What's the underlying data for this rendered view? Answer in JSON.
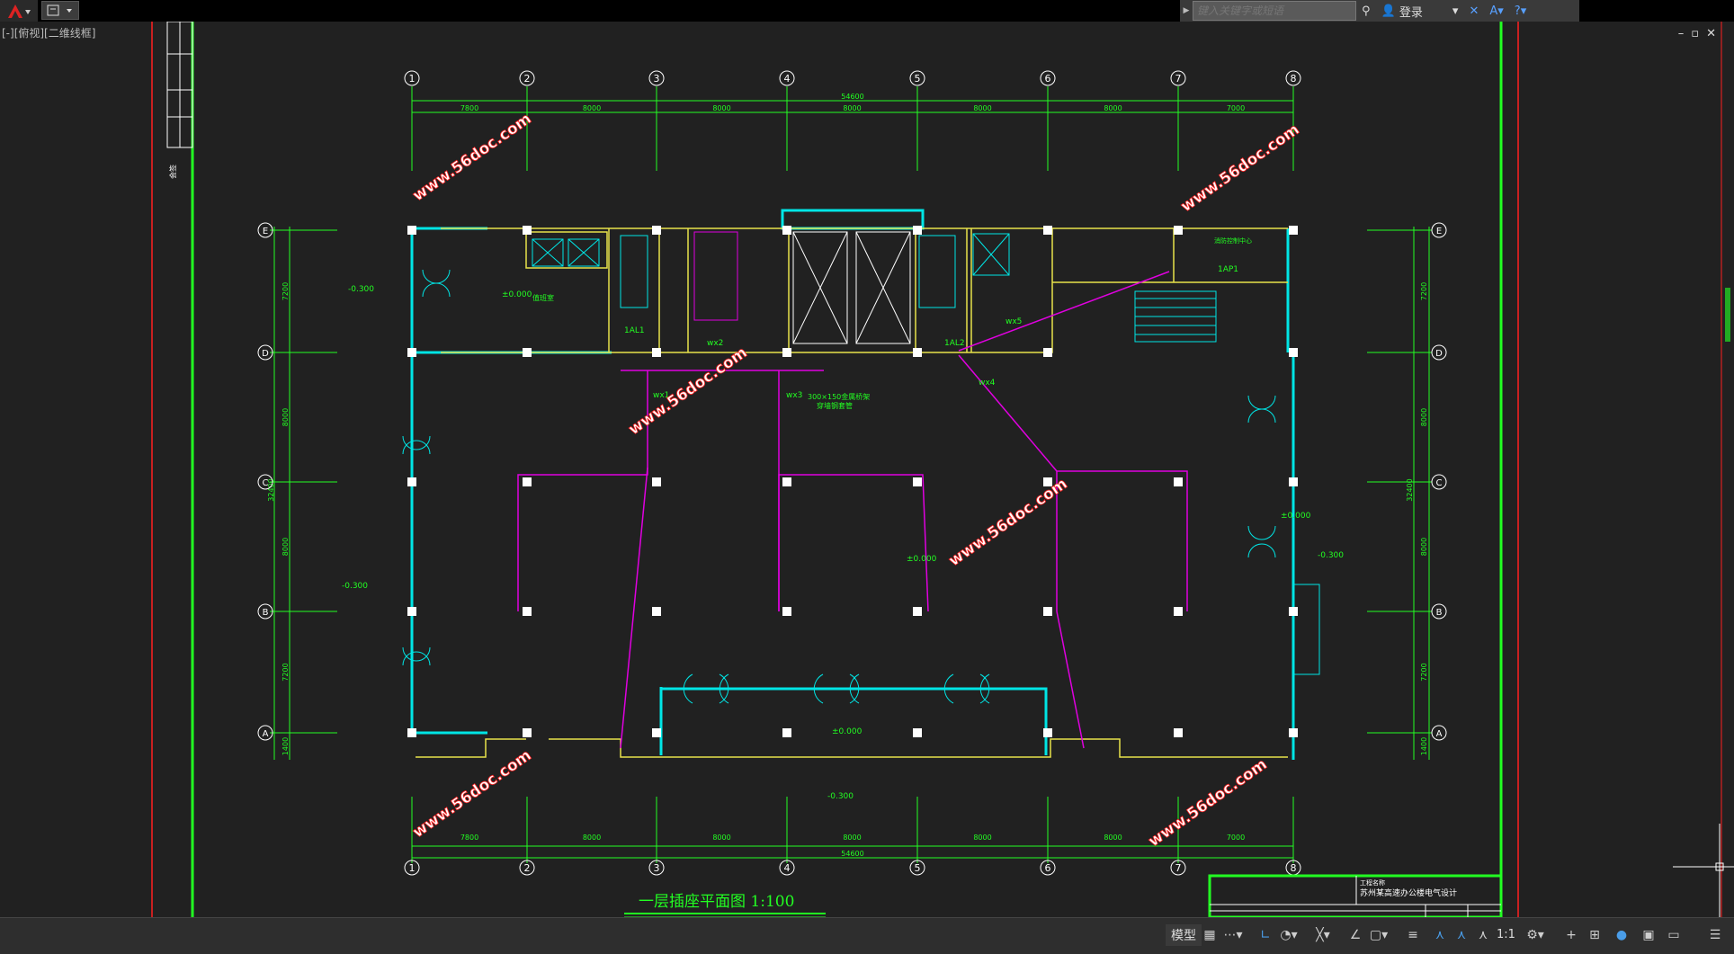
{
  "toolbar": {
    "search_placeholder": "键入关键字或短语",
    "login_label": "登录"
  },
  "viewport": {
    "label": "[-][俯视][二维线框]"
  },
  "drawing": {
    "title": "一层插座平面图  1:100",
    "total_dim": "54600",
    "bay_dims": [
      "7800",
      "8000",
      "8000",
      "8000",
      "8000",
      "8000",
      "7000"
    ],
    "grid_cols": [
      "1",
      "2",
      "3",
      "4",
      "5",
      "6",
      "7",
      "8"
    ],
    "grid_rows": [
      "E",
      "D",
      "C",
      "B",
      "A"
    ],
    "row_dims": [
      "7200",
      "8000",
      "8000",
      "7200",
      "1400"
    ],
    "row_total": "32400",
    "levels": {
      "outside_left_top": "-0.300",
      "outside_left_bottom": "-0.300",
      "inside_left": "±0.000",
      "center": "±0.000",
      "right": "±0.000",
      "outside_right": "-0.300",
      "bottom_inside": "±0.000",
      "bottom_outside": "-0.300"
    },
    "labels": {
      "panel1": "1AL1",
      "panel2": "1AL2",
      "panel3": "1AP1",
      "wx1": "wx1",
      "wx2": "wx2",
      "wx3": "wx3",
      "wx4": "wx4",
      "wx5": "wx5",
      "tray": "300×150金属桥架",
      "tray2": "穿墙钢套管",
      "room1": "值班室",
      "room2": "消防控制中心"
    },
    "watermark": "www.56doc.com",
    "titleblock": {
      "project": "苏州某高速办公楼电气设计",
      "header": "工程名称"
    }
  },
  "status": {
    "model_label": "模型",
    "scale_label": "1:1"
  },
  "colors": {
    "background": "#212121",
    "wall": "#00e5e5",
    "column": "#ffffff",
    "dim": "#00ff00",
    "wiring": "#e000e0",
    "frame": "#00ff00",
    "border_red": "#ff0000"
  }
}
